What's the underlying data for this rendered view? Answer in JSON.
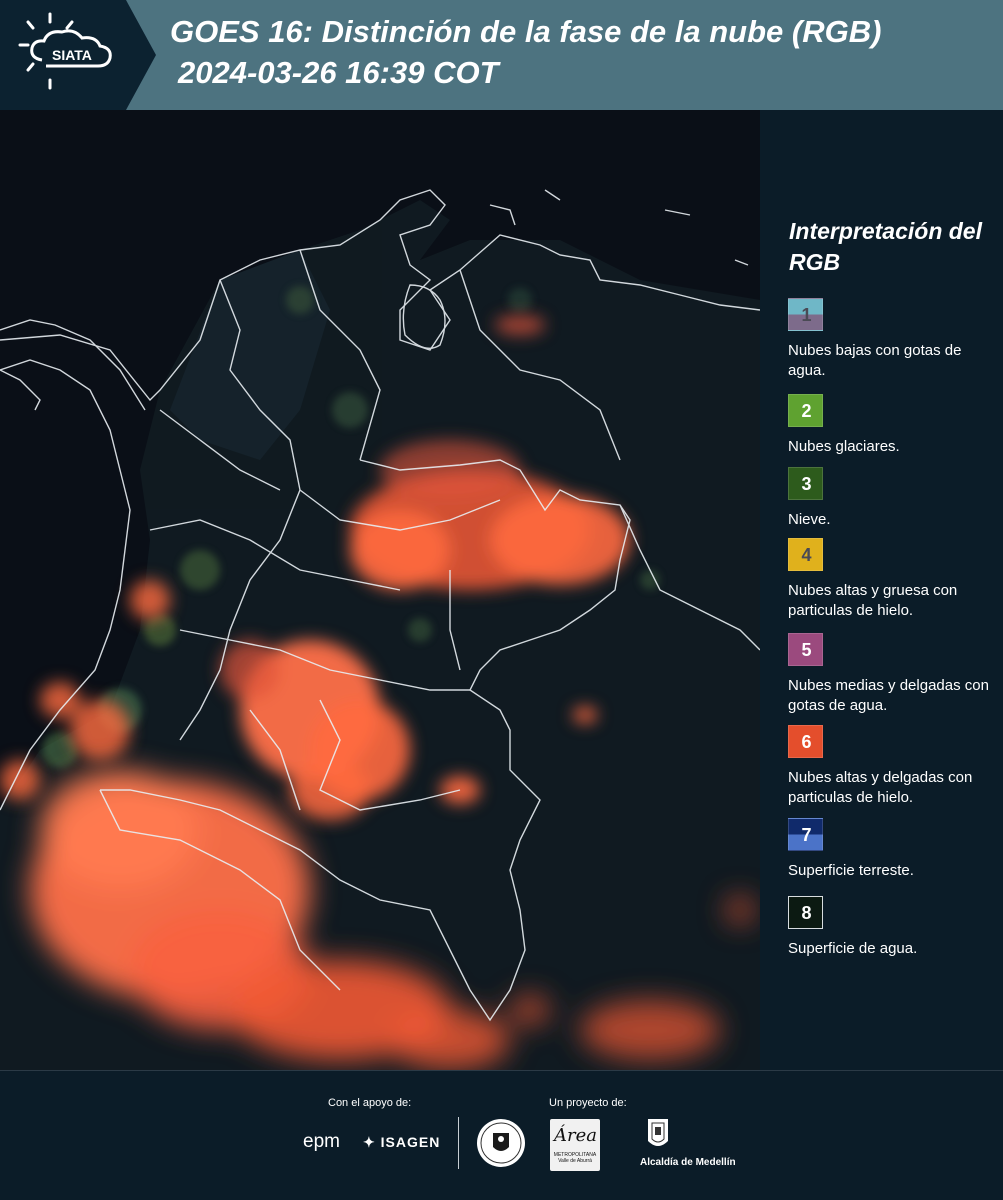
{
  "header": {
    "logo_text": "SIATA",
    "title_line1": "GOES 16: Distinción de la fase de la nube (RGB)",
    "title_line2": "2024-03-26 16:39 COT"
  },
  "map": {
    "icon": "satellite-rgb-map"
  },
  "legend": {
    "title": "Interpretación del RGB",
    "items": [
      {
        "number": "1",
        "label": "Nubes bajas con gotas de agua.",
        "color_top": "#6fb7c7",
        "color_bottom": "#7d6b8b",
        "number_color": "#4a4a55"
      },
      {
        "number": "2",
        "label": "Nubes glaciares.",
        "color_top": "#5fa230",
        "color_bottom": "#5fa230",
        "number_color": "#ffffff"
      },
      {
        "number": "3",
        "label": "Nieve.",
        "color_top": "#2d5b1c",
        "color_bottom": "#2d5b1c",
        "number_color": "#ffffff"
      },
      {
        "number": "4",
        "label": "Nubes altas y gruesa con particulas de hielo.",
        "color_top": "#e0b11c",
        "color_bottom": "#e0b11c",
        "number_color": "#4a4a55"
      },
      {
        "number": "5",
        "label": "Nubes medias y delgadas con gotas de agua.",
        "color_top": "#9b4a7e",
        "color_bottom": "#9b4a7e",
        "number_color": "#ffffff"
      },
      {
        "number": "6",
        "label": "Nubes altas y delgadas con particulas de hielo.",
        "color_top": "#e44e2c",
        "color_bottom": "#e44e2c",
        "number_color": "#ffffff"
      },
      {
        "number": "7",
        "label": "Superficie terreste.",
        "color_top": "#102a6b",
        "color_bottom": "#4b73c8",
        "number_color": "#ffffff"
      },
      {
        "number": "8",
        "label": "Superficie de agua.",
        "color_top": "#0c1a12",
        "color_bottom": "#0c1a12",
        "number_color": "#ffffff"
      }
    ]
  },
  "footer": {
    "support_caption": "Con el apoyo de:",
    "project_caption": "Un proyecto de:",
    "epm": "epm",
    "isagen": "ISAGEN",
    "amva": "Área",
    "amva_sub": "METROPOLITANA Valle de Aburrá",
    "medellin": "Alcaldía de Medellín"
  }
}
